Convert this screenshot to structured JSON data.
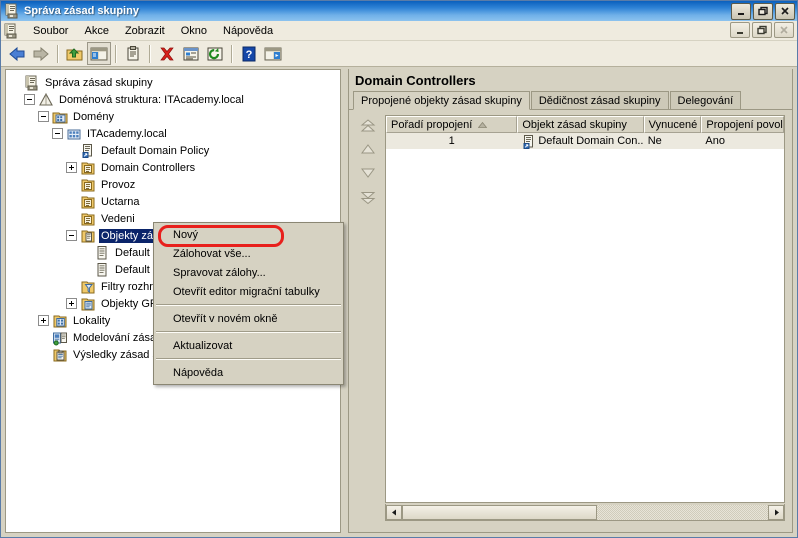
{
  "window": {
    "title": "Správa zásad skupiny",
    "icon": "gpmc-console-icon",
    "controls": {
      "minimize": "_",
      "maximize": "□",
      "close": "×"
    }
  },
  "menubar": {
    "icon": "mdi-child-window-icon",
    "items": [
      {
        "label": "Soubor",
        "name": "menu-soubor"
      },
      {
        "label": "Akce",
        "name": "menu-akce"
      },
      {
        "label": "Zobrazit",
        "name": "menu-zobrazit"
      },
      {
        "label": "Okno",
        "name": "menu-okno"
      },
      {
        "label": "Nápověda",
        "name": "menu-napoveda"
      }
    ],
    "controls": {
      "minimize": "_",
      "restore": "□",
      "close": "×"
    }
  },
  "toolbar": {
    "buttons": [
      {
        "name": "back-icon",
        "tip": "Zpět"
      },
      {
        "name": "forward-icon",
        "tip": "Vpřed"
      },
      {
        "name": "up-folder-icon",
        "tip": "Nahoru"
      },
      {
        "name": "show-hide-tree-icon",
        "tip": "Zobrazit/skrýt strom konzoly",
        "pressed": true
      },
      {
        "name": "properties-clipboard-icon",
        "tip": "Vlastnosti"
      },
      {
        "name": "delete-icon",
        "tip": "Odstranit"
      },
      {
        "name": "report-icon",
        "tip": "Sestava"
      },
      {
        "name": "refresh-icon",
        "tip": "Aktualizovat"
      },
      {
        "name": "help-icon",
        "tip": "Nápověda"
      },
      {
        "name": "show-action-pane-icon",
        "tip": "Podokno akcí"
      }
    ]
  },
  "tree": {
    "nodes": [
      {
        "label": "Správa zásad skupiny",
        "depth": 0,
        "expander": "none",
        "icon": "gpmc-console-icon",
        "selected": false
      },
      {
        "label": "Doménová struktura: ITAcademy.local",
        "depth": 1,
        "expander": "minus",
        "icon": "forest-icon",
        "selected": false
      },
      {
        "label": "Domény",
        "depth": 2,
        "expander": "minus",
        "icon": "domains-icon",
        "selected": false
      },
      {
        "label": "ITAcademy.local",
        "depth": 3,
        "expander": "minus",
        "icon": "domain-icon",
        "selected": false
      },
      {
        "label": "Default Domain Policy",
        "depth": 4,
        "expander": "none",
        "icon": "gpo-link-icon",
        "selected": false
      },
      {
        "label": "Domain Controllers",
        "depth": 4,
        "expander": "plus",
        "icon": "ou-icon",
        "selected": false
      },
      {
        "label": "Provoz",
        "depth": 4,
        "expander": "none",
        "icon": "ou-icon",
        "selected": false
      },
      {
        "label": "Uctarna",
        "depth": 4,
        "expander": "none",
        "icon": "ou-icon",
        "selected": false
      },
      {
        "label": "Vedeni",
        "depth": 4,
        "expander": "none",
        "icon": "ou-icon",
        "selected": false
      },
      {
        "label": "Objekty zásad skupiny",
        "depth": 4,
        "expander": "minus",
        "icon": "gpo-container-icon",
        "selected": true
      },
      {
        "label": "Default Domain Controllers Policy",
        "depth": 5,
        "expander": "none",
        "icon": "gpo-icon",
        "selected": false
      },
      {
        "label": "Default Domain Policy",
        "depth": 5,
        "expander": "none",
        "icon": "gpo-icon",
        "selected": false
      },
      {
        "label": "Filtry rozhraní WMI",
        "depth": 4,
        "expander": "none",
        "icon": "wmi-filter-icon",
        "selected": false
      },
      {
        "label": "Objekty GPO typu Starter",
        "depth": 4,
        "expander": "plus",
        "icon": "starter-gpo-icon",
        "selected": false
      },
      {
        "label": "Lokality",
        "depth": 2,
        "expander": "plus",
        "icon": "sites-icon",
        "selected": false
      },
      {
        "label": "Modelování zásad skupiny",
        "depth": 2,
        "expander": "none",
        "icon": "gp-modeling-icon",
        "selected": false
      },
      {
        "label": "Výsledky zásad skupiny",
        "depth": 2,
        "expander": "none",
        "icon": "gp-results-icon",
        "selected": false
      }
    ]
  },
  "right_pane": {
    "title": "Domain Controllers",
    "tabs": [
      {
        "label": "Propojené objekty zásad skupiny",
        "active": true
      },
      {
        "label": "Dědičnost zásad skupiny",
        "active": false
      },
      {
        "label": "Delegování",
        "active": false
      }
    ],
    "order_buttons": [
      {
        "name": "move-to-top-icon"
      },
      {
        "name": "move-up-icon"
      },
      {
        "name": "move-down-icon"
      },
      {
        "name": "move-to-bottom-icon"
      }
    ],
    "list": {
      "columns": [
        {
          "label": "Pořadí propojení",
          "width": 132,
          "sorted": true,
          "sort_dir": "asc"
        },
        {
          "label": "Objekt zásad skupiny",
          "width": 127,
          "sorted": false
        },
        {
          "label": "Vynucené",
          "width": 58,
          "sorted": false
        },
        {
          "label": "Propojení povol",
          "width": 83,
          "sorted": false
        }
      ],
      "rows": [
        {
          "order": "1",
          "gpo": "Default Domain Con...",
          "gpo_icon": "gpo-link-icon",
          "enforced": "Ne",
          "link_enabled": "Ano"
        }
      ]
    },
    "hscrollbar": {
      "left_arrow": "◄",
      "right_arrow": "►"
    }
  },
  "context_menu": {
    "items": [
      {
        "label": "Nový",
        "type": "item",
        "highlighted": true
      },
      {
        "label": "Zálohovat vše...",
        "type": "item"
      },
      {
        "label": "Spravovat zálohy...",
        "type": "item"
      },
      {
        "label": "Otevřít editor migrační tabulky",
        "type": "item"
      },
      {
        "type": "separator"
      },
      {
        "label": "Otevřít v novém okně",
        "type": "item"
      },
      {
        "type": "separator"
      },
      {
        "label": "Aktualizovat",
        "type": "item"
      },
      {
        "type": "separator"
      },
      {
        "label": "Nápověda",
        "type": "item"
      }
    ]
  },
  "annotation": {
    "shape": "rounded-rect",
    "color": "#e8201c",
    "targets": "Nový"
  },
  "colors": {
    "title_bar_start": "#0a5fbd",
    "title_bar_end": "#8cc3ee",
    "chrome": "#d6d2c2",
    "menu_bg": "#efebdf",
    "selection": "#0a246a",
    "annotation_red": "#e8201c"
  }
}
